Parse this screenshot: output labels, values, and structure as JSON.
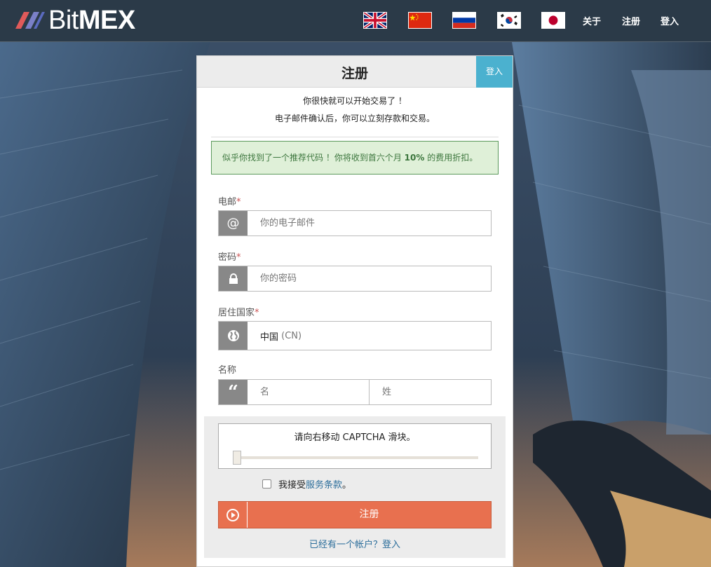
{
  "brand": {
    "name_light": "Bit",
    "name_bold": "MEX"
  },
  "nav": {
    "flags": [
      {
        "name": "english-flag",
        "lang": "en"
      },
      {
        "name": "chinese-flag",
        "lang": "zh"
      },
      {
        "name": "russian-flag",
        "lang": "ru"
      },
      {
        "name": "korean-flag",
        "lang": "ko"
      },
      {
        "name": "japanese-flag",
        "lang": "ja"
      }
    ],
    "about": "关于",
    "register": "注册",
    "login": "登入"
  },
  "card": {
    "title": "注册",
    "login_tab": "登入",
    "intro_line1": "你很快就可以开始交易了 ！",
    "intro_line2": "电子邮件确认后，你可以立刻存款和交易。",
    "alert_prefix": "似乎你找到了一个推荐代码 ！你将收到首六个月",
    "alert_bold": "10%",
    "alert_suffix": "的费用折扣。"
  },
  "form": {
    "email_label": "电邮",
    "email_placeholder": "你的电子邮件",
    "password_label": "密码",
    "password_placeholder": "你的密码",
    "country_label": "居住国家",
    "country_value": "中国",
    "country_code": "(CN)",
    "name_label": "名称",
    "first_name_placeholder": "名",
    "last_name_placeholder": "姓",
    "required_mark": "*"
  },
  "captcha": {
    "text": "请向右移动 CAPTCHA 滑块。",
    "progress": 0
  },
  "terms": {
    "prefix": "我接受",
    "link": "服务条款",
    "suffix": "。",
    "checked": false
  },
  "submit": {
    "label": "注册"
  },
  "have_account": "已经有一个帐户？登入",
  "colors": {
    "topbar": "#2b3a48",
    "accent": "#4bb1cf",
    "submit": "#e8704f",
    "alert_bg": "#dff0d8",
    "link": "#2c6e9b"
  }
}
